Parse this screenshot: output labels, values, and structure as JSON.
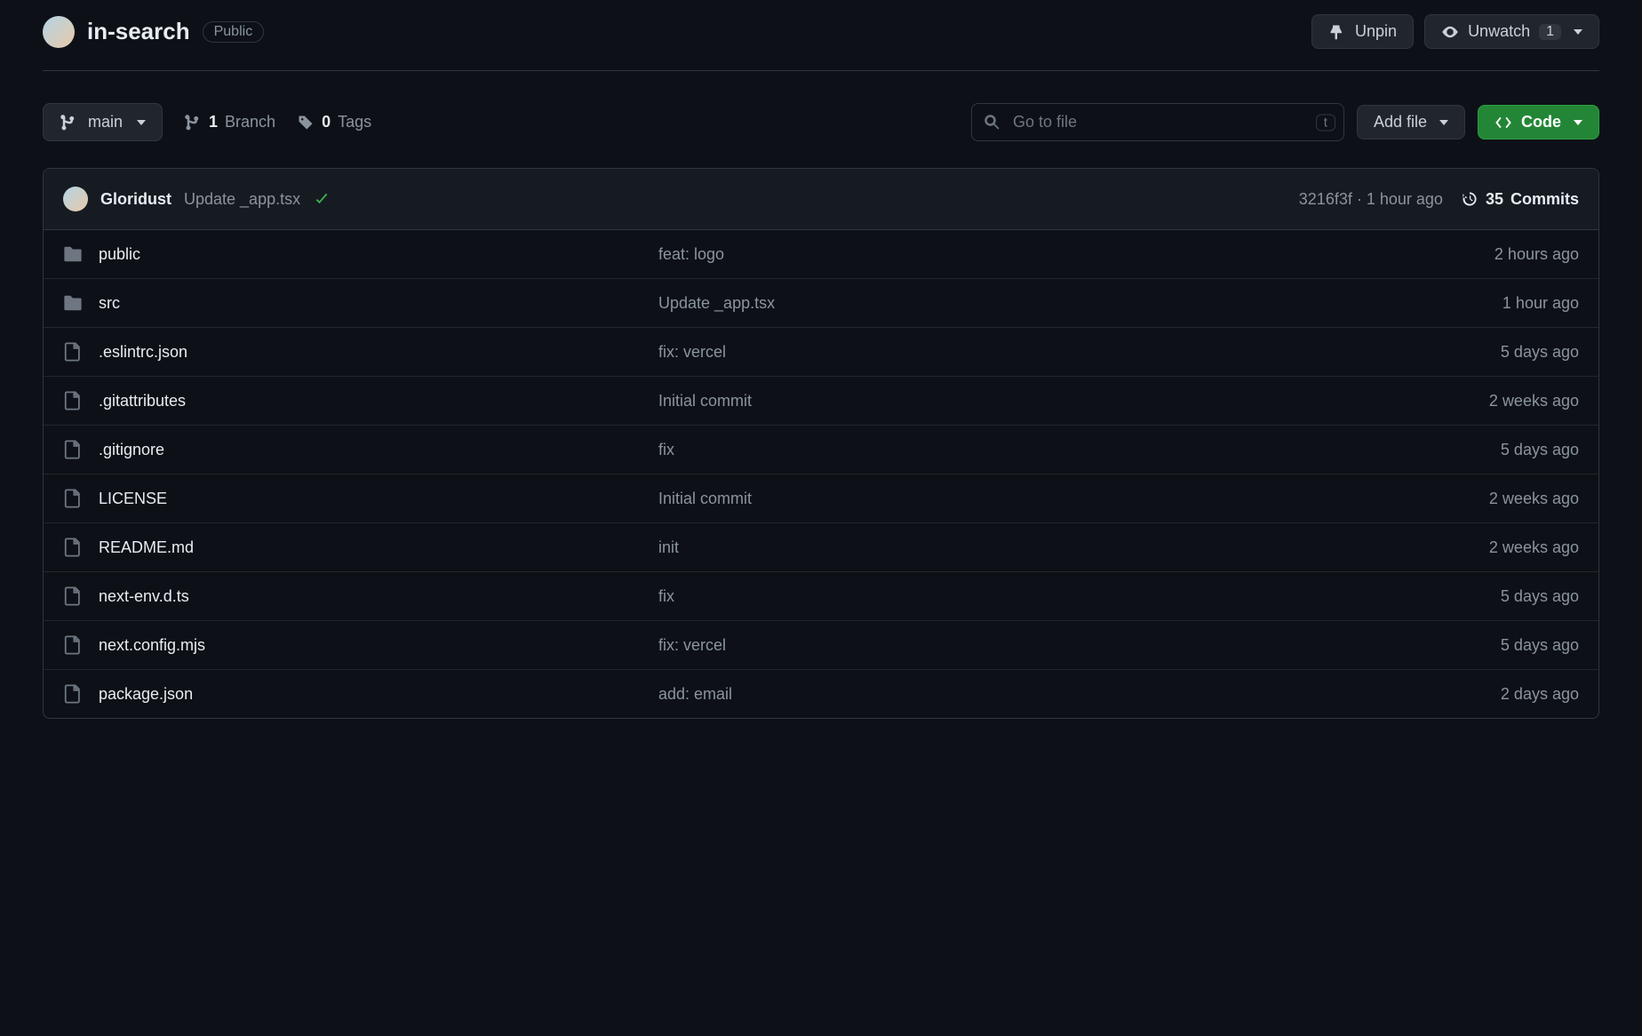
{
  "header": {
    "repo_name": "in-search",
    "visibility": "Public",
    "unpin_label": "Unpin",
    "unwatch_label": "Unwatch",
    "watch_count": "1"
  },
  "toolbar": {
    "branch_name": "main",
    "branch_count": "1",
    "branch_label": "Branch",
    "tag_count": "0",
    "tag_label": "Tags",
    "search_placeholder": "Go to file",
    "search_kbd": "t",
    "add_file_label": "Add file",
    "code_label": "Code"
  },
  "commit": {
    "author": "Gloridust",
    "message": "Update _app.tsx",
    "hash": "3216f3f",
    "separator": "·",
    "time": "1 hour ago",
    "commits_count": "35",
    "commits_label": "Commits"
  },
  "files": [
    {
      "type": "dir",
      "name": "public",
      "msg": "feat: logo",
      "time": "2 hours ago"
    },
    {
      "type": "dir",
      "name": "src",
      "msg": "Update _app.tsx",
      "time": "1 hour ago"
    },
    {
      "type": "file",
      "name": ".eslintrc.json",
      "msg": "fix: vercel",
      "time": "5 days ago"
    },
    {
      "type": "file",
      "name": ".gitattributes",
      "msg": "Initial commit",
      "time": "2 weeks ago"
    },
    {
      "type": "file",
      "name": ".gitignore",
      "msg": "fix",
      "time": "5 days ago"
    },
    {
      "type": "file",
      "name": "LICENSE",
      "msg": "Initial commit",
      "time": "2 weeks ago"
    },
    {
      "type": "file",
      "name": "README.md",
      "msg": "init",
      "time": "2 weeks ago"
    },
    {
      "type": "file",
      "name": "next-env.d.ts",
      "msg": "fix",
      "time": "5 days ago"
    },
    {
      "type": "file",
      "name": "next.config.mjs",
      "msg": "fix: vercel",
      "time": "5 days ago"
    },
    {
      "type": "file",
      "name": "package.json",
      "msg": "add: email",
      "time": "2 days ago"
    }
  ]
}
